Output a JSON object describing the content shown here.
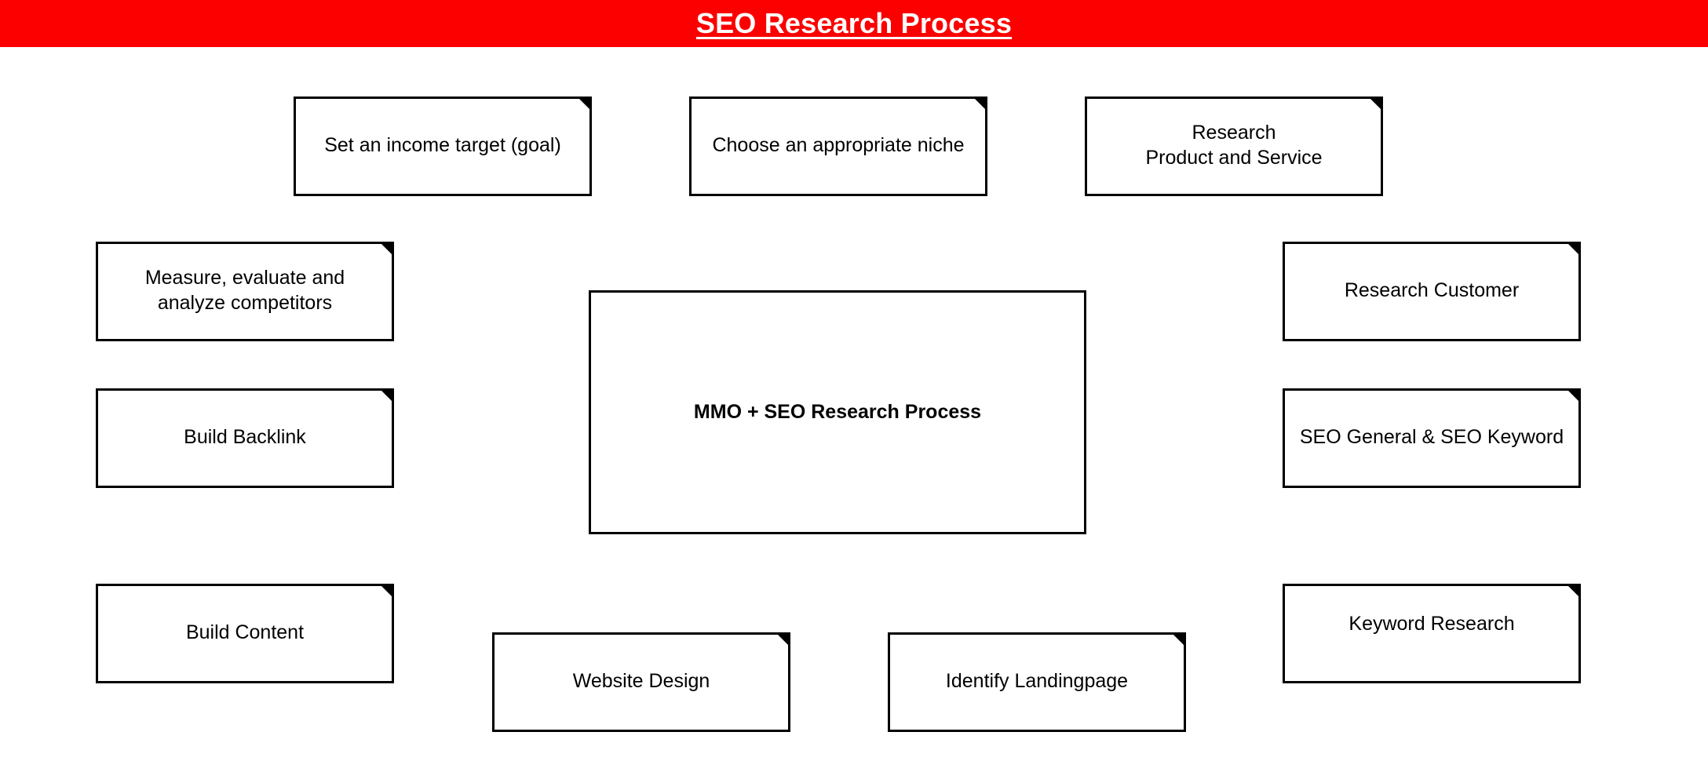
{
  "header": {
    "title": "SEO Research Process",
    "background_color": "#fc0000",
    "text_color": "#ffffff"
  },
  "diagram": {
    "type": "mind-map",
    "background_color": "#ffffff",
    "node_border_color": "#000000",
    "node_fill_color": "#ffffff",
    "node_text_color": "#000000",
    "center": {
      "label": "MMO + SEO Research Process"
    },
    "nodes": [
      {
        "id": "income-target",
        "label": "Set an income target (goal)"
      },
      {
        "id": "niche",
        "label": "Choose an appropriate niche"
      },
      {
        "id": "product-service",
        "label": "Research\nProduct and Service"
      },
      {
        "id": "competitors",
        "label": "Measure, evaluate and\nanalyze competitors"
      },
      {
        "id": "research-customer",
        "label": "Research Customer"
      },
      {
        "id": "build-backlink",
        "label": "Build Backlink"
      },
      {
        "id": "seo-general",
        "label": "SEO General & SEO Keyword"
      },
      {
        "id": "build-content",
        "label": "Build Content"
      },
      {
        "id": "keyword-research",
        "label": "Keyword Research"
      },
      {
        "id": "website-design",
        "label": "Website Design"
      },
      {
        "id": "identify-landingpage",
        "label": "Identify Landingpage"
      }
    ]
  }
}
